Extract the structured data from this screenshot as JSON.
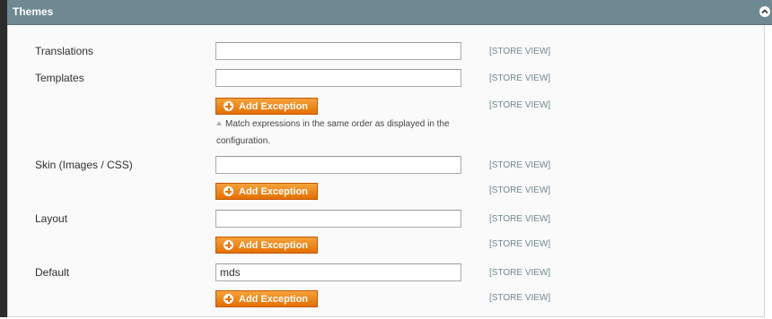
{
  "section": {
    "title": "Themes"
  },
  "scope_label": "[STORE VIEW]",
  "button_label": "Add Exception",
  "note": "Match expressions in the same order as displayed in the configuration.",
  "fields": {
    "translations": {
      "label": "Translations",
      "value": ""
    },
    "templates": {
      "label": "Templates",
      "value": ""
    },
    "skin": {
      "label": "Skin (Images / CSS)",
      "value": ""
    },
    "layout": {
      "label": "Layout",
      "value": ""
    },
    "default": {
      "label": "Default",
      "value": "mds"
    }
  },
  "colors": {
    "header_bg": "#6f8992",
    "button_orange": "#e46f00",
    "scope_text": "#6f8992"
  },
  "icons": {
    "collapse": "chevron-up-icon",
    "add": "plus-circle-icon",
    "note": "triangle-up-icon"
  }
}
